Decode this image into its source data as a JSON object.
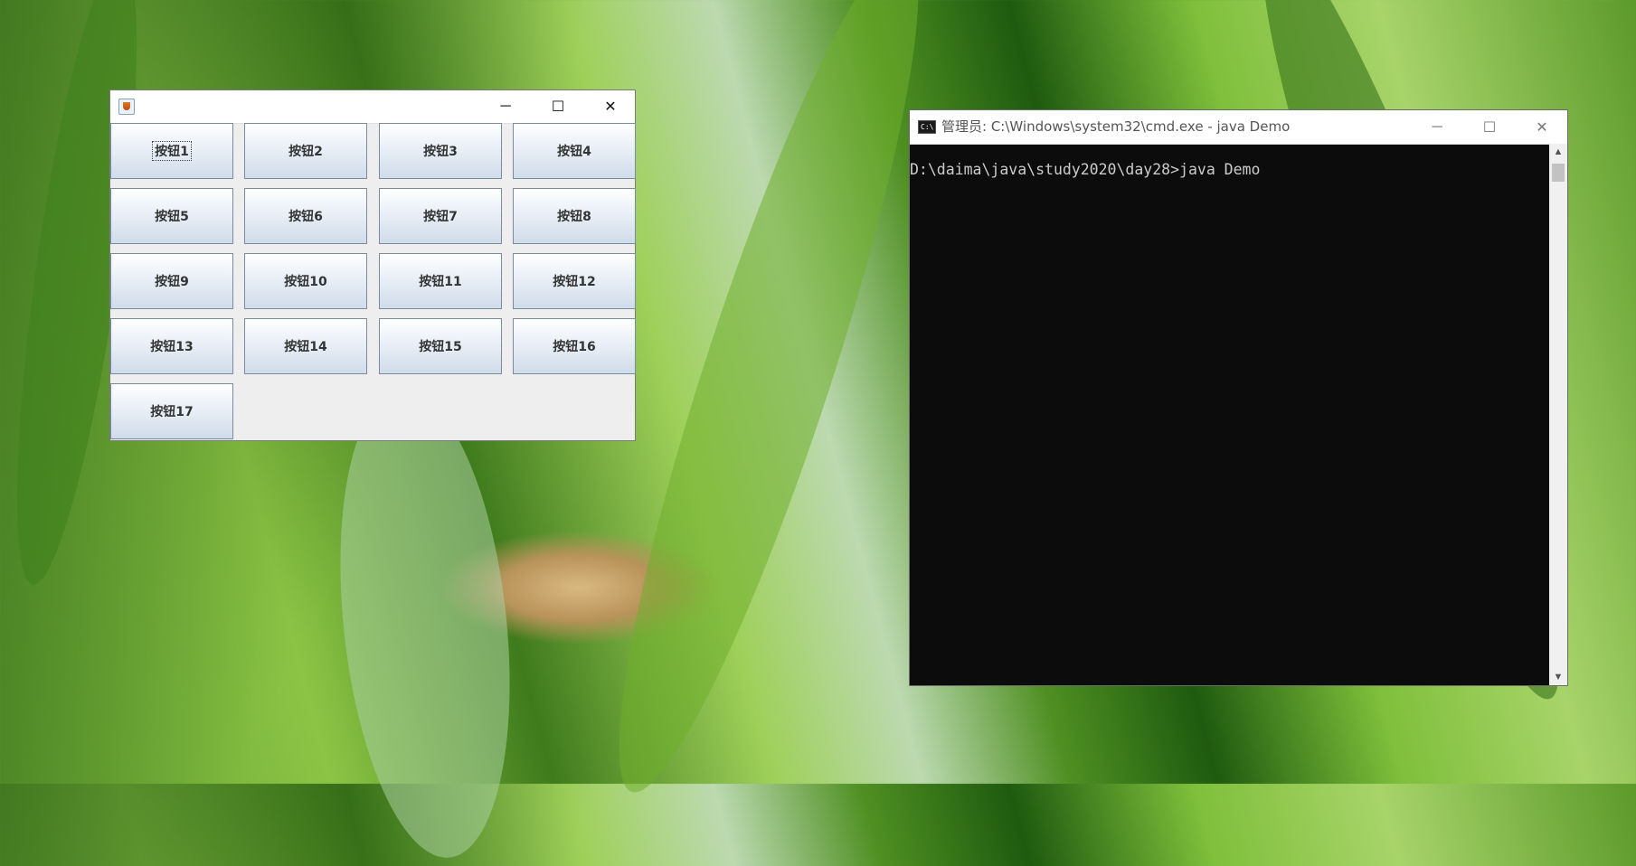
{
  "java_window": {
    "title": "",
    "controls": {
      "minimize": "─",
      "maximize": "☐",
      "close": "✕"
    },
    "buttons": [
      "按钮1",
      "按钮2",
      "按钮3",
      "按钮4",
      "按钮5",
      "按钮6",
      "按钮7",
      "按钮8",
      "按钮9",
      "按钮10",
      "按钮11",
      "按钮12",
      "按钮13",
      "按钮14",
      "按钮15",
      "按钮16",
      "按钮17"
    ],
    "focused_button": "按钮1"
  },
  "cmd_window": {
    "title": "管理员: C:\\Windows\\system32\\cmd.exe - java  Demo",
    "icon_text": "C:\\",
    "controls": {
      "minimize": "─",
      "maximize": "☐",
      "close": "✕"
    },
    "lines": [
      "D:\\daima\\java\\study2020\\day28>java Demo"
    ],
    "scroll_up": "▲",
    "scroll_down": "▼"
  }
}
